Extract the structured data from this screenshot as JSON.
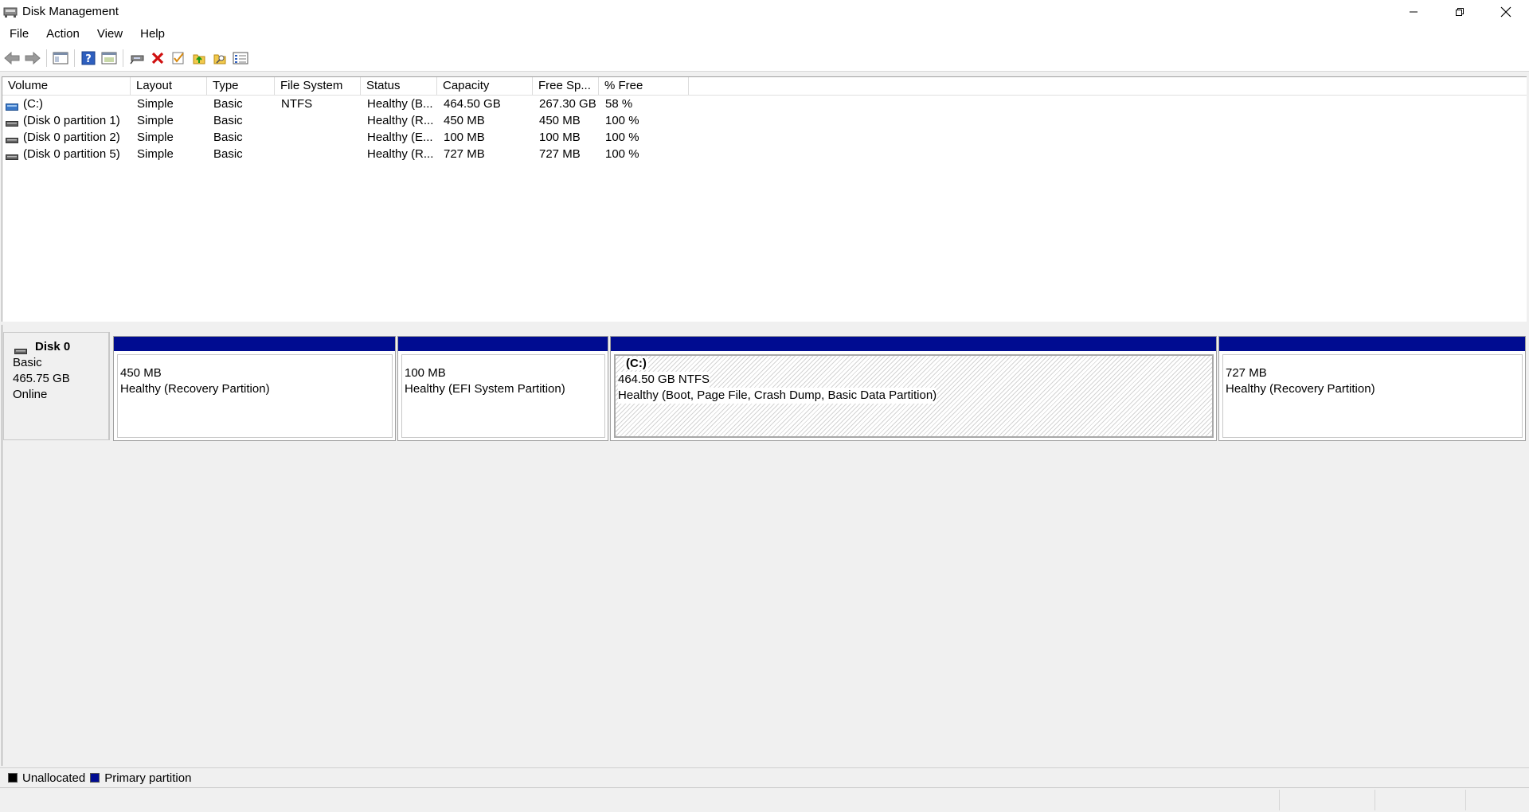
{
  "window": {
    "title": "Disk Management"
  },
  "menu": {
    "items": [
      "File",
      "Action",
      "View",
      "Help"
    ]
  },
  "toolbar": {
    "icons": [
      "back-arrow-icon",
      "forward-arrow-icon",
      "show-hide-console-tree-icon",
      "help-icon",
      "properties-icon",
      "connect-drive-icon",
      "delete-icon",
      "check-icon",
      "export-list-icon",
      "search-folder-icon",
      "settings-list-icon"
    ]
  },
  "volume_table": {
    "columns": [
      "Volume",
      "Layout",
      "Type",
      "File System",
      "Status",
      "Capacity",
      "Free Sp...",
      "% Free"
    ],
    "rows": [
      {
        "volume": "(C:)",
        "layout": "Simple",
        "type": "Basic",
        "fs": "NTFS",
        "status": "Healthy (B...",
        "capacity": "464.50 GB",
        "free": "267.30 GB",
        "pct": "58 %",
        "icon": "blue-drive-icon"
      },
      {
        "volume": "(Disk 0 partition 1)",
        "layout": "Simple",
        "type": "Basic",
        "fs": "",
        "status": "Healthy (R...",
        "capacity": "450 MB",
        "free": "450 MB",
        "pct": "100 %",
        "icon": "gray-drive-icon"
      },
      {
        "volume": "(Disk 0 partition 2)",
        "layout": "Simple",
        "type": "Basic",
        "fs": "",
        "status": "Healthy (E...",
        "capacity": "100 MB",
        "free": "100 MB",
        "pct": "100 %",
        "icon": "gray-drive-icon"
      },
      {
        "volume": "(Disk 0 partition 5)",
        "layout": "Simple",
        "type": "Basic",
        "fs": "",
        "status": "Healthy (R...",
        "capacity": "727 MB",
        "free": "727 MB",
        "pct": "100 %",
        "icon": "gray-drive-icon"
      }
    ]
  },
  "disk": {
    "name": "Disk 0",
    "type": "Basic",
    "size": "465.75 GB",
    "state": "Online",
    "partitions": [
      {
        "name": "",
        "size": "450 MB",
        "status": "Healthy (Recovery Partition)"
      },
      {
        "name": "",
        "size": "100 MB",
        "status": "Healthy (EFI System Partition)"
      },
      {
        "name": "(C:)",
        "size": "464.50 GB NTFS",
        "status": "Healthy (Boot, Page File, Crash Dump, Basic Data Partition)"
      },
      {
        "name": "",
        "size": "727 MB",
        "status": "Healthy (Recovery Partition)"
      }
    ]
  },
  "legend": {
    "unallocated": "Unallocated",
    "primary": "Primary partition",
    "unallocated_color": "#000000",
    "primary_color": "#000c91"
  }
}
